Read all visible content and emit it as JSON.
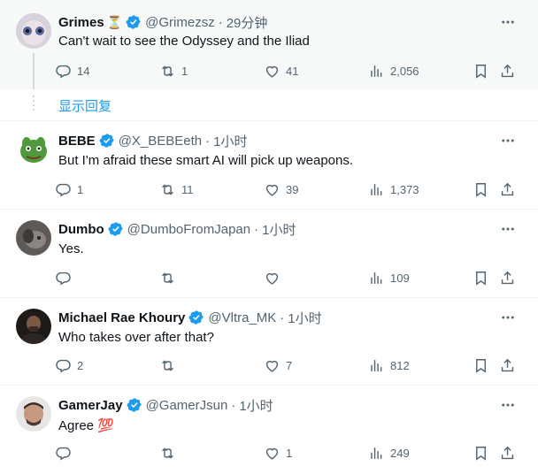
{
  "tweets": [
    {
      "name": "Grimes",
      "badge_emoji": "⏳",
      "handle": "@Grimezsz",
      "time": "29分钟",
      "text": "Can't wait to see the Odyssey and the Iliad",
      "replies": "14",
      "retweets": "1",
      "likes": "41",
      "views": "2,056"
    },
    {
      "name": "BEBE",
      "handle": "@X_BEBEeth",
      "time": "1小时",
      "text": "But I'm afraid these smart AI will pick up weapons.",
      "replies": "1",
      "retweets": "11",
      "likes": "39",
      "views": "1,373"
    },
    {
      "name": "Dumbo",
      "handle": "@DumboFromJapan",
      "time": "1小时",
      "text": "Yes.",
      "replies": "",
      "retweets": "",
      "likes": "",
      "views": "109"
    },
    {
      "name": "Michael Rae Khoury",
      "handle": "@Vltra_MK",
      "time": "1小时",
      "text": "Who takes over after that?",
      "replies": "2",
      "retweets": "",
      "likes": "7",
      "views": "812"
    },
    {
      "name": "GamerJay",
      "handle": "@GamerJsun",
      "time": "1小时",
      "text": "Agree 💯",
      "replies": "",
      "retweets": "",
      "likes": "1",
      "views": "249"
    }
  ],
  "show_replies_label": "显示回复",
  "separator_dot": "·",
  "colors": {
    "verified": "#1d9bf0",
    "link": "#1d9bf0",
    "muted": "#536471",
    "text": "#0f1419"
  },
  "icons": [
    "verified-badge-icon",
    "more-icon",
    "reply-icon",
    "retweet-icon",
    "like-icon",
    "views-icon",
    "bookmark-icon",
    "share-icon"
  ]
}
